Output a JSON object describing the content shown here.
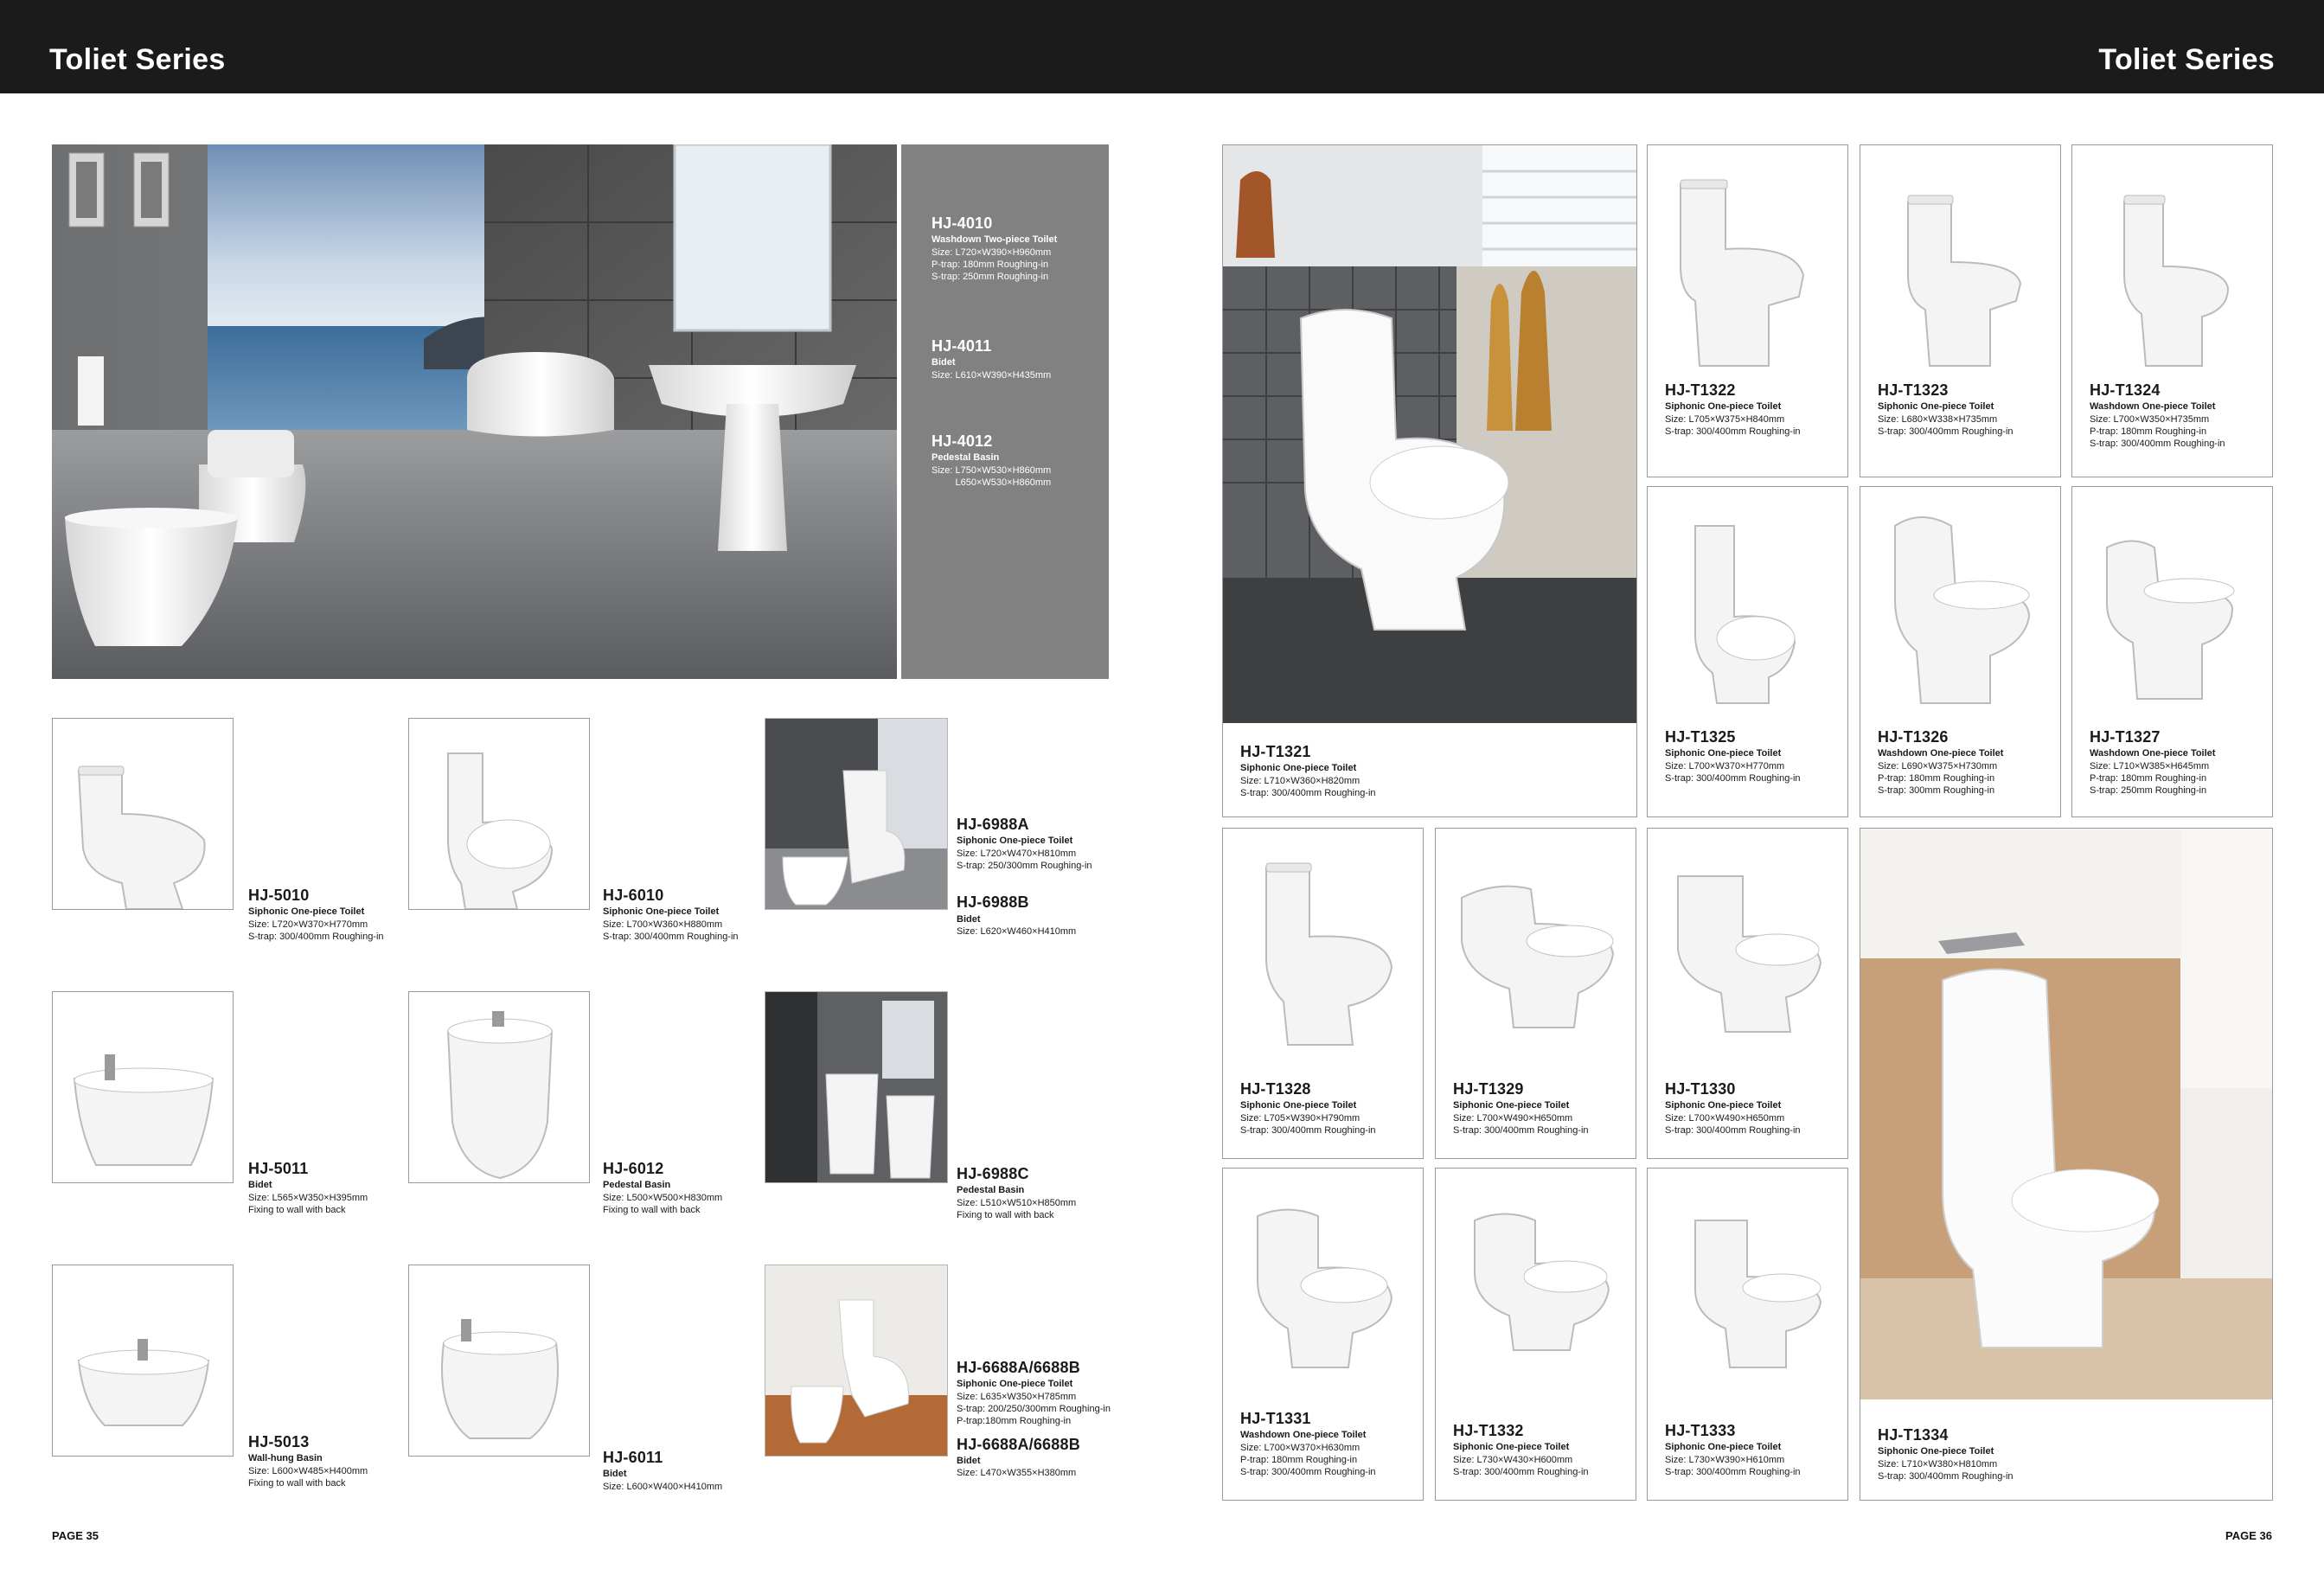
{
  "header": {
    "left_title": "Toliet Series",
    "right_title": "Toliet Series"
  },
  "footer": {
    "left_page": "PAGE 35",
    "right_page": "PAGE 36"
  },
  "hero": {
    "items": [
      {
        "code": "HJ-4010",
        "desc": "Washdown Two-piece Toilet",
        "specs": [
          "Size: L720×W390×H960mm",
          "P-trap: 180mm  Roughing-in",
          "S-trap: 250mm  Roughing-in"
        ]
      },
      {
        "code": "HJ-4011",
        "desc": "Bidet",
        "specs": [
          "Size: L610×W390×H435mm"
        ]
      },
      {
        "code": "HJ-4012",
        "desc": "Pedestal Basin",
        "specs": [
          "Size: L750×W530×H860mm",
          "         L650×W530×H860mm"
        ]
      }
    ]
  },
  "left_products": [
    {
      "code": "HJ-5010",
      "desc": "Siphonic One-piece Toilet",
      "specs": [
        "Size: L720×W370×H770mm",
        "S-trap: 300/400mm  Roughing-in"
      ],
      "icon": "one-piece-toilet-icon"
    },
    {
      "code": "HJ-6010",
      "desc": "Siphonic One-piece Toilet",
      "specs": [
        "Size: L700×W360×H880mm",
        "S-trap: 300/400mm  Roughing-in"
      ],
      "icon": "tall-toilet-icon"
    },
    {
      "code": "HJ-5011",
      "desc": "Bidet",
      "specs": [
        "Size: L565×W350×H395mm",
        "Fixing to wall with back"
      ],
      "icon": "bidet-icon"
    },
    {
      "code": "HJ-6012",
      "desc": "Pedestal Basin",
      "specs": [
        "Size: L500×W500×H830mm",
        "Fixing to wall with back"
      ],
      "icon": "pedestal-basin-icon"
    },
    {
      "code": "HJ-5013",
      "desc": "Wall-hung Basin",
      "specs": [
        "Size: L600×W485×H400mm",
        "Fixing to wall with back"
      ],
      "icon": "wall-basin-icon"
    },
    {
      "code": "HJ-6011",
      "desc": "Bidet",
      "specs": [
        "Size: L600×W400×H410mm"
      ],
      "icon": "bidet-icon"
    }
  ],
  "scene_products": [
    {
      "items": [
        {
          "code": "HJ-6988A",
          "desc": "Siphonic One-piece Toilet",
          "specs": [
            "Size: L720×W470×H810mm",
            "S-trap: 250/300mm  Roughing-in"
          ]
        },
        {
          "code": "HJ-6988B",
          "desc": "Bidet",
          "specs": [
            "Size: L620×W460×H410mm"
          ]
        }
      ]
    },
    {
      "items": [
        {
          "code": "HJ-6988C",
          "desc": "Pedestal Basin",
          "specs": [
            "Size: L510×W510×H850mm",
            "Fixing to wall with back"
          ]
        }
      ]
    },
    {
      "items": [
        {
          "code": "HJ-6688A/6688B",
          "desc": "Siphonic One-piece Toilet",
          "specs": [
            "Size: L635×W350×H785mm",
            "S-trap: 200/250/300mm  Roughing-in",
            "P-trap:180mm Roughing-in"
          ]
        },
        {
          "code": "HJ-6688A/6688B",
          "desc": "Bidet",
          "specs": [
            "Size: L470×W355×H380mm"
          ]
        }
      ]
    }
  ],
  "right_products": [
    {
      "code": "HJ-T1321",
      "desc": "Siphonic One-piece Toilet",
      "specs": [
        "Size: L710×W360×H820mm",
        "S-trap: 300/400mm  Roughing-in"
      ]
    },
    {
      "code": "HJ-T1322",
      "desc": "Siphonic One-piece Toilet",
      "specs": [
        "Size: L705×W375×H840mm",
        "S-trap: 300/400mm  Roughing-in"
      ]
    },
    {
      "code": "HJ-T1323",
      "desc": "Siphonic One-piece Toilet",
      "specs": [
        "Size: L680×W338×H735mm",
        "S-trap: 300/400mm  Roughing-in"
      ]
    },
    {
      "code": "HJ-T1324",
      "desc": "Washdown One-piece Toilet",
      "specs": [
        "Size: L700×W350×H735mm",
        "P-trap: 180mm  Roughing-in",
        "S-trap: 300/400mm  Roughing-in"
      ]
    },
    {
      "code": "HJ-T1325",
      "desc": "Siphonic One-piece Toilet",
      "specs": [
        "Size: L700×W370×H770mm",
        "S-trap: 300/400mm  Roughing-in"
      ]
    },
    {
      "code": "HJ-T1326",
      "desc": "Washdown One-piece Toilet",
      "specs": [
        "Size: L690×W375×H730mm",
        "P-trap: 180mm  Roughing-in",
        "S-trap: 300mm  Roughing-in"
      ]
    },
    {
      "code": "HJ-T1327",
      "desc": "Washdown One-piece Toilet",
      "specs": [
        "Size: L710×W385×H645mm",
        "P-trap: 180mm  Roughing-in",
        "S-trap: 250mm  Roughing-in"
      ]
    },
    {
      "code": "HJ-T1328",
      "desc": "Siphonic One-piece Toilet",
      "specs": [
        "Size: L705×W390×H790mm",
        "S-trap: 300/400mm  Roughing-in"
      ]
    },
    {
      "code": "HJ-T1329",
      "desc": "Siphonic One-piece Toilet",
      "specs": [
        "Size: L700×W490×H650mm",
        "S-trap: 300/400mm  Roughing-in"
      ]
    },
    {
      "code": "HJ-T1330",
      "desc": "Siphonic One-piece Toilet",
      "specs": [
        "Size: L700×W490×H650mm",
        "S-trap: 300/400mm  Roughing-in"
      ]
    },
    {
      "code": "HJ-T1331",
      "desc": "Washdown One-piece Toilet",
      "specs": [
        "Size: L700×W370×H630mm",
        "P-trap: 180mm  Roughing-in",
        "S-trap: 300/400mm  Roughing-in"
      ]
    },
    {
      "code": "HJ-T1332",
      "desc": "Siphonic One-piece Toilet",
      "specs": [
        "Size: L730×W430×H600mm",
        "S-trap: 300/400mm  Roughing-in"
      ]
    },
    {
      "code": "HJ-T1333",
      "desc": "Siphonic One-piece Toilet",
      "specs": [
        "Size: L730×W390×H610mm",
        "S-trap: 300/400mm  Roughing-in"
      ]
    },
    {
      "code": "HJ-T1334",
      "desc": "Siphonic One-piece Toilet",
      "specs": [
        "Size: L710×W380×H810mm",
        "S-trap: 300/400mm  Roughing-in"
      ]
    }
  ]
}
